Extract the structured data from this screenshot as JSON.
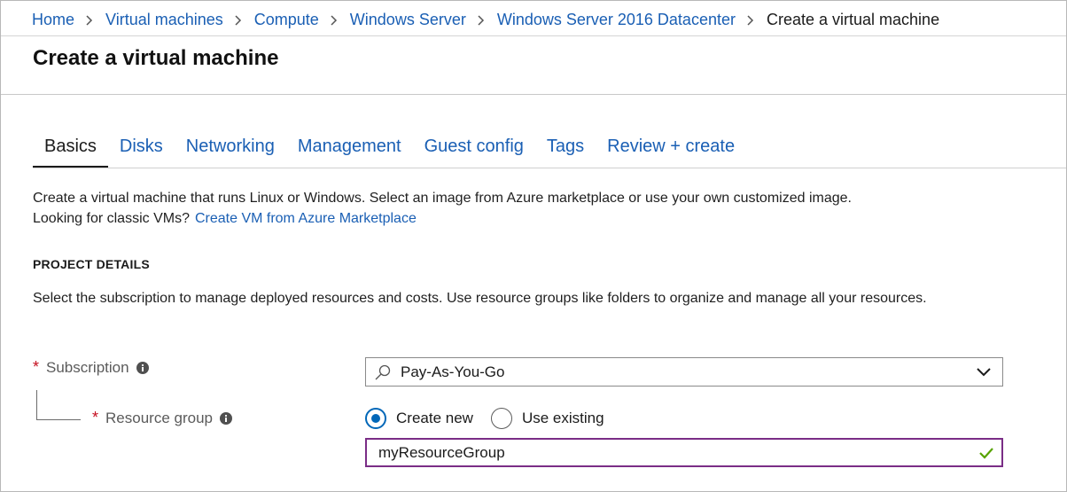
{
  "breadcrumb": {
    "items": [
      "Home",
      "Virtual machines",
      "Compute",
      "Windows Server",
      "Windows Server 2016 Datacenter"
    ],
    "current": "Create a virtual machine"
  },
  "page": {
    "title": "Create a virtual machine"
  },
  "tabs": [
    {
      "label": "Basics",
      "active": true
    },
    {
      "label": "Disks",
      "active": false
    },
    {
      "label": "Networking",
      "active": false
    },
    {
      "label": "Management",
      "active": false
    },
    {
      "label": "Guest config",
      "active": false
    },
    {
      "label": "Tags",
      "active": false
    },
    {
      "label": "Review + create",
      "active": false
    }
  ],
  "intro": {
    "line1": "Create a virtual machine that runs Linux or Windows. Select an image from Azure marketplace or use your own customized image.",
    "line2": "Looking for classic VMs?",
    "link": "Create VM from Azure Marketplace"
  },
  "project": {
    "heading": "PROJECT DETAILS",
    "description": "Select the subscription to manage deployed resources and costs. Use resource groups like folders to organize and manage all your resources."
  },
  "subscription": {
    "required_mark": "*",
    "label": "Subscription",
    "value": "Pay-As-You-Go",
    "icon": "search-icon"
  },
  "resource_group": {
    "required_mark": "*",
    "label": "Resource group",
    "options": {
      "create_new": "Create new",
      "use_existing": "Use existing"
    },
    "selected": "create_new",
    "value": "myResourceGroup"
  },
  "colors": {
    "link": "#1a5fb4",
    "required": "#c50f1f",
    "radio_selected": "#0067b8",
    "input_focus_border": "#7a2d86",
    "valid_check": "#57a300"
  }
}
